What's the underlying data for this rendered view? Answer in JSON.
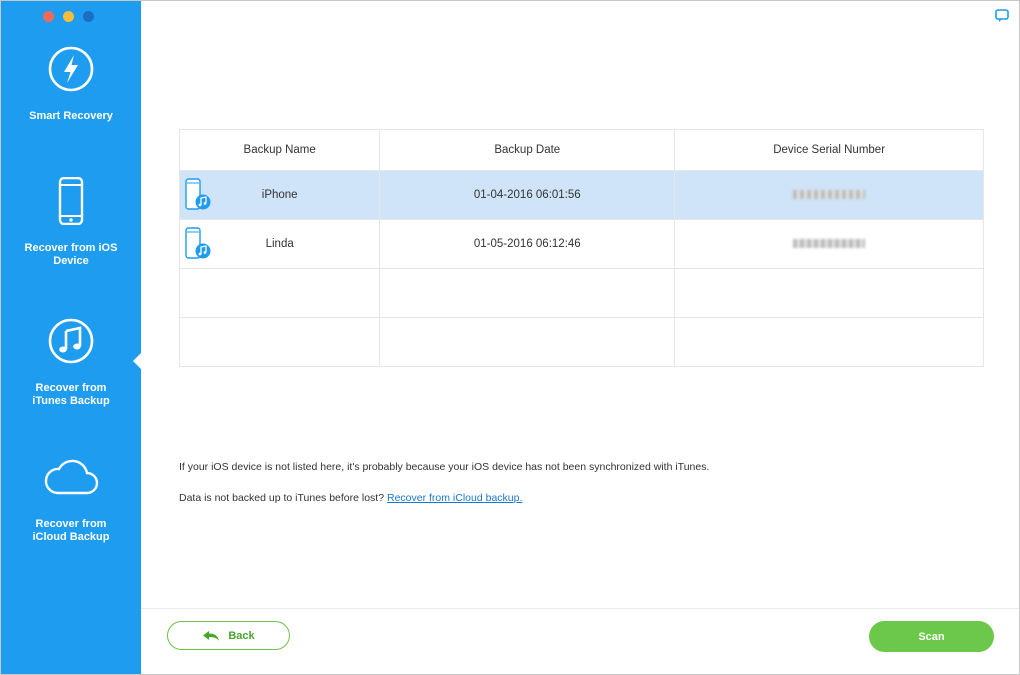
{
  "sidebar": {
    "items": [
      {
        "label": "Smart Recovery",
        "icon": "lightning-icon"
      },
      {
        "label": "Recover from iOS\nDevice",
        "icon": "iphone-icon"
      },
      {
        "label": "Recover from\niTunes Backup",
        "icon": "music-note-icon"
      },
      {
        "label": "Recover from\niCloud Backup",
        "icon": "cloud-icon"
      }
    ],
    "active_index": 2
  },
  "table": {
    "headers": [
      "Backup Name",
      "Backup Date",
      "Device Serial Number"
    ],
    "rows": [
      {
        "name": "iPhone",
        "date": "01-04-2016 06:01:56",
        "selected": true
      },
      {
        "name": "Linda",
        "date": "01-05-2016 06:12:46",
        "selected": false
      }
    ]
  },
  "notes": {
    "line1": "If your iOS device is not listed here, it's probably because your iOS device has not been synchronized with iTunes.",
    "line2_prefix": "Data is not backed up to iTunes before lost?",
    "line2_link": "Recover from iCloud backup."
  },
  "buttons": {
    "back": "Back",
    "scan": "Scan"
  },
  "colors": {
    "sidebar": "#1e9cf0",
    "selected_row": "#cfe4f8",
    "green": "#6cc84a",
    "link": "#1a77d2"
  }
}
